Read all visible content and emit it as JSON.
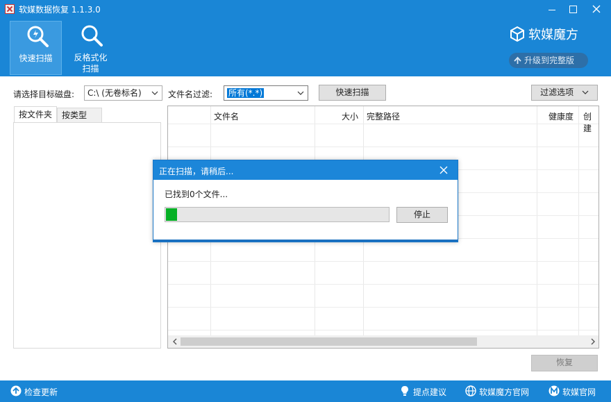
{
  "window": {
    "title": "软媒数据恢复 1.1.3.0"
  },
  "toolbar": {
    "quick_scan_label": "快速扫描",
    "format_scan_line1": "反格式化",
    "format_scan_line2": "扫描"
  },
  "brand": {
    "name": "软媒魔方",
    "upgrade_label": "升级到完整版"
  },
  "filters": {
    "disk_label": "请选择目标磁盘:",
    "disk_value": "C:\\  (无卷标名)",
    "filename_label": "文件名过滤:",
    "filename_value": "所有(*.*)",
    "quick_scan_button": "快速扫描",
    "filter_options_button": "过滤选项"
  },
  "left_panel": {
    "tabs": [
      {
        "label": "按文件夹"
      },
      {
        "label": "按类型"
      }
    ]
  },
  "table": {
    "columns": [
      "文件名",
      "大小",
      "完整路径",
      "健康度",
      "创建"
    ]
  },
  "restore_button": "恢复",
  "dialog": {
    "title": "正在扫描，请稍后...",
    "found_text": "已找到0个文件...",
    "progress": 0.05,
    "stop_button": "停止"
  },
  "statusbar": {
    "check_update": "检查更新",
    "suggest": "提点建议",
    "official_mofang": "软媒魔方官网",
    "official_ruanmei": "软媒官网"
  },
  "colors": {
    "accent": "#1a86d6",
    "progress_fill": "#06b025"
  }
}
